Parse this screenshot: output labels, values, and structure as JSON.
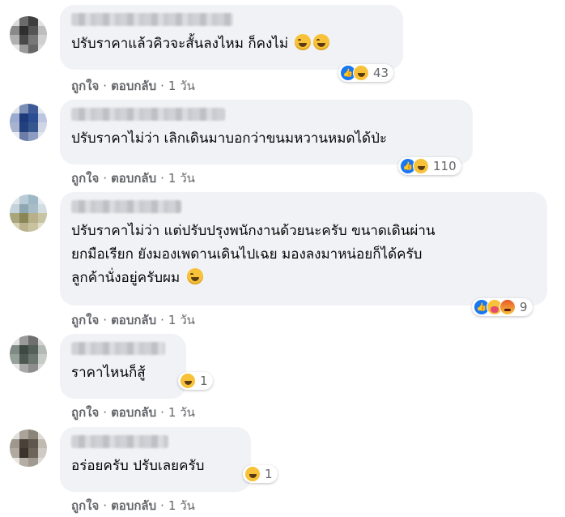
{
  "comments": [
    {
      "text": "ปรับราคาแล้วคิวจะสั้นลงไหม ก็คงไม่",
      "reaction_count": "43",
      "reactions": [
        "like-icon",
        "haha-icon"
      ],
      "like_label": "ถูกใจ",
      "reply_label": "ตอบกลับ",
      "time": "1 วัน"
    },
    {
      "text": "ปรับราคาไม่ว่า เลิกเดินมาบอกว่าขนมหวานหมดได้ป่ะ",
      "reaction_count": "110",
      "reactions": [
        "like-icon",
        "haha-icon"
      ],
      "like_label": "ถูกใจ",
      "reply_label": "ตอบกลับ",
      "time": "1 วัน"
    },
    {
      "lines": [
        "ปรับราคาไม่ว่า แต่ปรับปรุงพนักงานด้วยนะครับ ขนาดเดินผ่าน",
        "ยกมือเรียก ยังมองเพดานเดินไปเฉย มองลงมาหน่อยก็ได้ครับ",
        "ลูกค้านั่งอยู่ครับผม"
      ],
      "reaction_count": "9",
      "reactions": [
        "like-icon",
        "care-icon",
        "angry-icon"
      ],
      "like_label": "ถูกใจ",
      "reply_label": "ตอบกลับ",
      "time": "1 วัน"
    },
    {
      "text": "ราคาไหนก็สู้",
      "reaction_count": "1",
      "reactions": [
        "haha-icon"
      ],
      "like_label": "ถูกใจ",
      "reply_label": "ตอบกลับ",
      "time": "1 วัน"
    },
    {
      "text": "อร่อยครับ ปรับเลยครับ",
      "reaction_count": "1",
      "reactions": [
        "haha-icon"
      ],
      "like_label": "ถูกใจ",
      "reply_label": "ตอบกลับ",
      "time": "1 วัน"
    }
  ],
  "dot_separator": "·"
}
